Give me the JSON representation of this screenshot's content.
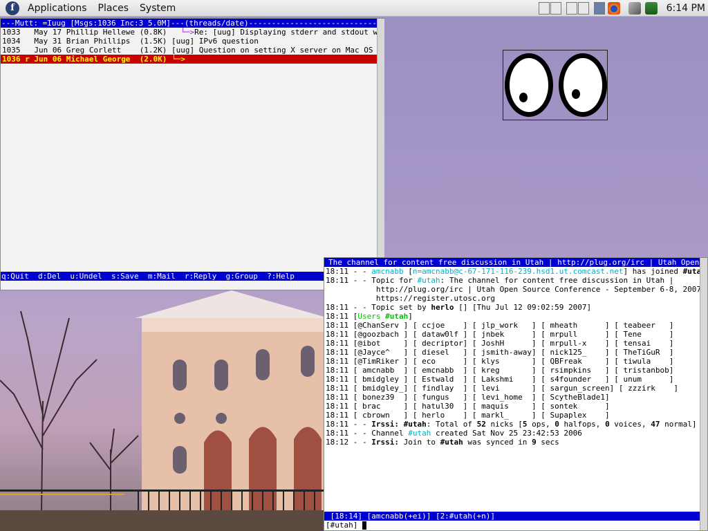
{
  "panel": {
    "menus": [
      "Applications",
      "Places",
      "System"
    ],
    "clock": "6:14 PM"
  },
  "mutt": {
    "header": "---Mutt: =Iuug [Msgs:1036 Inc:3 5.0M]---(threads/date)-----------------------------(end)---",
    "rows": [
      {
        "num": "1033",
        "date": "May 17",
        "from": "Phillip Hellewe",
        "size": "(0.8K)",
        "arrow": "  └─>",
        "subject": "Re: [uug] Displaying stderr and stdout while w",
        "selected": false
      },
      {
        "num": "1034",
        "date": "May 31",
        "from": "Brian Phillips ",
        "size": "(1.5K)",
        "arrow": "",
        "subject": "[uug] IPv6 question",
        "selected": false
      },
      {
        "num": "1035",
        "date": "Jun 06",
        "from": "Greg Corlett   ",
        "size": "(1.2K)",
        "arrow": "",
        "subject": "[uug] Question on setting X server on Mac OS X Tige",
        "selected": false
      },
      {
        "num": "1036 r",
        "date": "Jun 06",
        "from": "Michael George ",
        "size": "(2.0K)",
        "arrow": "└─>",
        "subject": "",
        "selected": true
      }
    ],
    "footer": "q:Quit  d:Del  u:Undel  s:Save  m:Mail  r:Reply  g:Group  ?:Help"
  },
  "irssi": {
    "topic_bar": "The channel for content free discussion in Utah | http://plug.org/irc | Utah Open Source",
    "lines": [
      [
        {
          "t": "18:11 - - "
        },
        {
          "t": "amcnabb",
          "c": "cy"
        },
        {
          "t": " ["
        },
        {
          "t": "n=amcnabb@c-67-171-116-239.hsd1.ut.comcast.net",
          "c": "cy"
        },
        {
          "t": "] has joined "
        },
        {
          "t": "#utah",
          "c": "b"
        }
      ],
      [
        {
          "t": "18:11 - - Topic for "
        },
        {
          "t": "#utah",
          "c": "cy"
        },
        {
          "t": ": The channel for content free discussion in Utah |"
        }
      ],
      [
        {
          "t": "           http://plug.org/irc | Utah Open Source Conference - September 6-8, 2007 -"
        }
      ],
      [
        {
          "t": "           https://register.utosc.org"
        }
      ],
      [
        {
          "t": "18:11 - - Topic set by "
        },
        {
          "t": "herlo",
          "c": "b"
        },
        {
          "t": " [] [Thu Jul 12 09:02:59 2007]"
        }
      ],
      [
        {
          "t": "18:11 ["
        },
        {
          "t": "Users ",
          "c": "gr"
        },
        {
          "t": "#utah",
          "c": "gr b"
        },
        {
          "t": "]"
        }
      ],
      [
        {
          "t": "18:11 [@ChanServ ] [ ccjoe    ] [ jlp_work   ] [ mheath      ] [ teabeer   ]"
        }
      ],
      [
        {
          "t": "18:11 [@goozbach ] [ dataw0lf ] [ jnbek      ] [ mrpull      ] [ Tene      ]"
        }
      ],
      [
        {
          "t": "18:11 [@ibot     ] [ decriptor] [ JoshH      ] [ mrpull-x    ] [ tensai    ]"
        }
      ],
      [
        {
          "t": "18:11 [@Jayce^   ] [ diesel   ] [ jsmith-away] [ nick125_    ] [ TheTiGuR  ]"
        }
      ],
      [
        {
          "t": "18:11 [@TimRiker ] [ eco      ] [ klys       ] [ QBFreak     ] [ tiwula    ]"
        }
      ],
      [
        {
          "t": "18:11 [ amcnabb  ] [ emcnabb  ] [ kreg       ] [ rsimpkins   ] [ tristanbob]"
        }
      ],
      [
        {
          "t": "18:11 [ bmidgley ] [ Estwald  ] [ Lakshmi    ] [ s4founder   ] [ unum      ]"
        }
      ],
      [
        {
          "t": "18:11 [ bmidgley_] [ findlay  ] [ levi       ] [ sargun_screen] [ zzzirk    ]"
        }
      ],
      [
        {
          "t": "18:11 [ bonez39  ] [ fungus   ] [ levi_home  ] [ ScytheBlade1]"
        }
      ],
      [
        {
          "t": "18:11 [ brac     ] [ hatul30  ] [ maquis     ] [ sontek      ]"
        }
      ],
      [
        {
          "t": "18:11 [ cbrown   ] [ herlo    ] [ markl_     ] [ Supaplex    ]"
        }
      ],
      [
        {
          "t": "18:11 - - "
        },
        {
          "t": "Irssi:",
          "c": "b"
        },
        {
          "t": " "
        },
        {
          "t": "#utah",
          "c": "b"
        },
        {
          "t": ": Total of "
        },
        {
          "t": "52",
          "c": "b"
        },
        {
          "t": " nicks ["
        },
        {
          "t": "5",
          "c": "b"
        },
        {
          "t": " ops, "
        },
        {
          "t": "0",
          "c": "b"
        },
        {
          "t": " halfops, "
        },
        {
          "t": "0",
          "c": "b"
        },
        {
          "t": " voices, "
        },
        {
          "t": "47",
          "c": "b"
        },
        {
          "t": " normal]"
        }
      ],
      [
        {
          "t": "18:11 - - Channel "
        },
        {
          "t": "#utah",
          "c": "cy"
        },
        {
          "t": " created Sat Nov 25 23:42:53 2006"
        }
      ],
      [
        {
          "t": "18:12 - - "
        },
        {
          "t": "Irssi:",
          "c": "b"
        },
        {
          "t": " Join to "
        },
        {
          "t": "#utah",
          "c": "b"
        },
        {
          "t": " was synced in "
        },
        {
          "t": "9",
          "c": "b"
        },
        {
          "t": " secs"
        }
      ]
    ],
    "status": " [18:14] [amcnabb(+ei)] [2:#utah(+n)]",
    "prompt": "[#utah] "
  }
}
